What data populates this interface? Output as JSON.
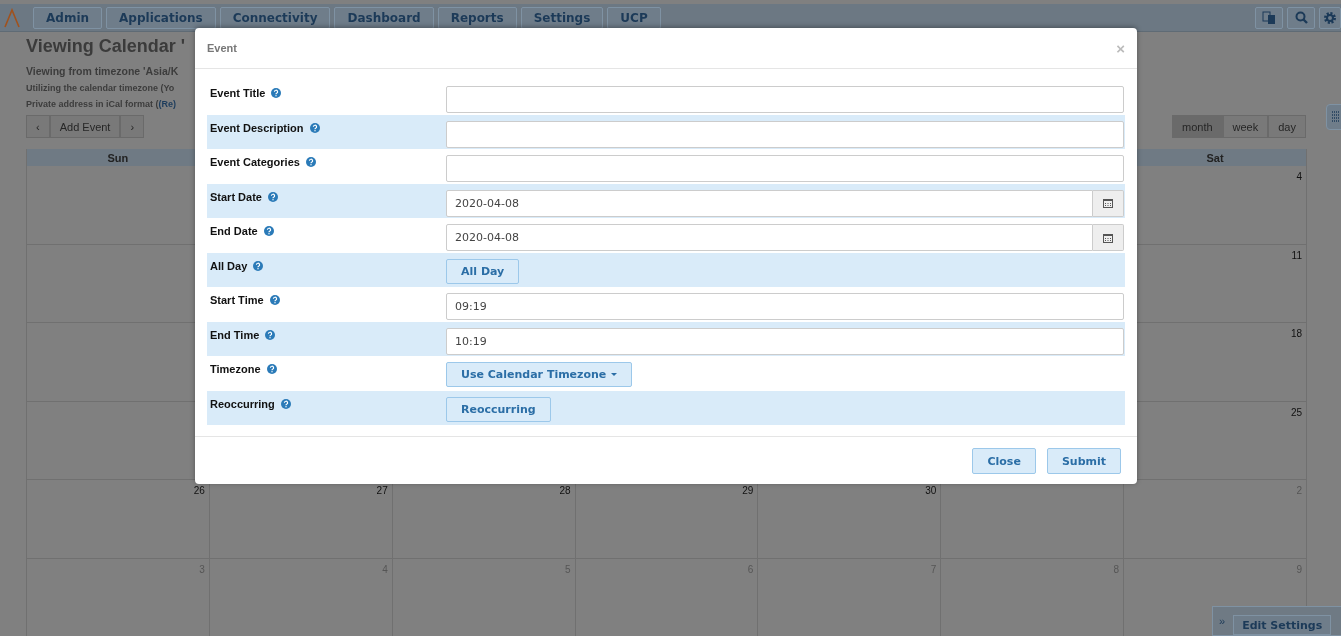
{
  "nav": {
    "items": [
      "Admin",
      "Applications",
      "Connectivity",
      "Dashboard",
      "Reports",
      "Settings",
      "UCP"
    ]
  },
  "page": {
    "title": "Viewing Calendar '",
    "lines": [
      {
        "kind": "sub",
        "text": "Viewing from timezone 'Asia/K"
      },
      {
        "kind": "small",
        "text": "Utilizing the calendar timezone (Yo"
      },
      {
        "kind": "small",
        "text": "Private address in iCal format (",
        "link": "(Re)"
      }
    ]
  },
  "calendar_toolbar": {
    "prev": "‹",
    "add": "Add Event",
    "next": "›",
    "views": [
      {
        "label": "month",
        "selected": true
      },
      {
        "label": "week",
        "selected": false
      },
      {
        "label": "day",
        "selected": false
      }
    ]
  },
  "calendar": {
    "headers": {
      "sun": "Sun",
      "sat": "Sat"
    },
    "weeks": [
      {
        "sat": {
          "day": "4",
          "other_month": false
        }
      },
      {
        "sat": {
          "day": "11",
          "other_month": false
        }
      },
      {
        "sat": {
          "day": "18",
          "other_month": false
        }
      },
      {
        "sat": {
          "day": "25",
          "other_month": false
        }
      },
      {
        "sun": {
          "day": "26",
          "other_month": false
        },
        "mon": {
          "day": "27",
          "other_month": false
        },
        "tue": {
          "day": "28",
          "other_month": false
        },
        "wed": {
          "day": "29",
          "other_month": false
        },
        "thu": {
          "day": "30",
          "other_month": false
        },
        "sat": {
          "day": "2",
          "other_month": true
        }
      },
      {
        "sun": {
          "day": "3",
          "other_month": true
        },
        "mon": {
          "day": "4",
          "other_month": true
        },
        "tue": {
          "day": "5",
          "other_month": true
        },
        "wed": {
          "day": "6",
          "other_month": true
        },
        "thu": {
          "day": "7",
          "other_month": true
        },
        "fri": {
          "day": "8",
          "other_month": true
        },
        "sat": {
          "day": "9",
          "other_month": true
        }
      }
    ]
  },
  "edit_settings": {
    "label": "Edit Settings",
    "icon": "»"
  },
  "modal": {
    "title": "Event",
    "close": "×",
    "fields": [
      {
        "label": "Event Title",
        "kind": "text"
      },
      {
        "label": "Event Description",
        "kind": "text"
      },
      {
        "label": "Event Categories",
        "kind": "text"
      },
      {
        "label": "Start Date",
        "kind": "date",
        "value": "2020-04-08"
      },
      {
        "label": "End Date",
        "kind": "date",
        "value": "2020-04-08"
      },
      {
        "label": "All Day",
        "kind": "button",
        "button": "All Day"
      },
      {
        "label": "Start Time",
        "kind": "text",
        "value": "09:19"
      },
      {
        "label": "End Time",
        "kind": "text",
        "value": "10:19"
      },
      {
        "label": "Timezone",
        "kind": "dropdown",
        "button": "Use Calendar Timezone"
      },
      {
        "label": "Reoccurring",
        "kind": "button",
        "button": "Reoccurring"
      }
    ],
    "buttons": [
      "Close",
      "Submit"
    ]
  }
}
